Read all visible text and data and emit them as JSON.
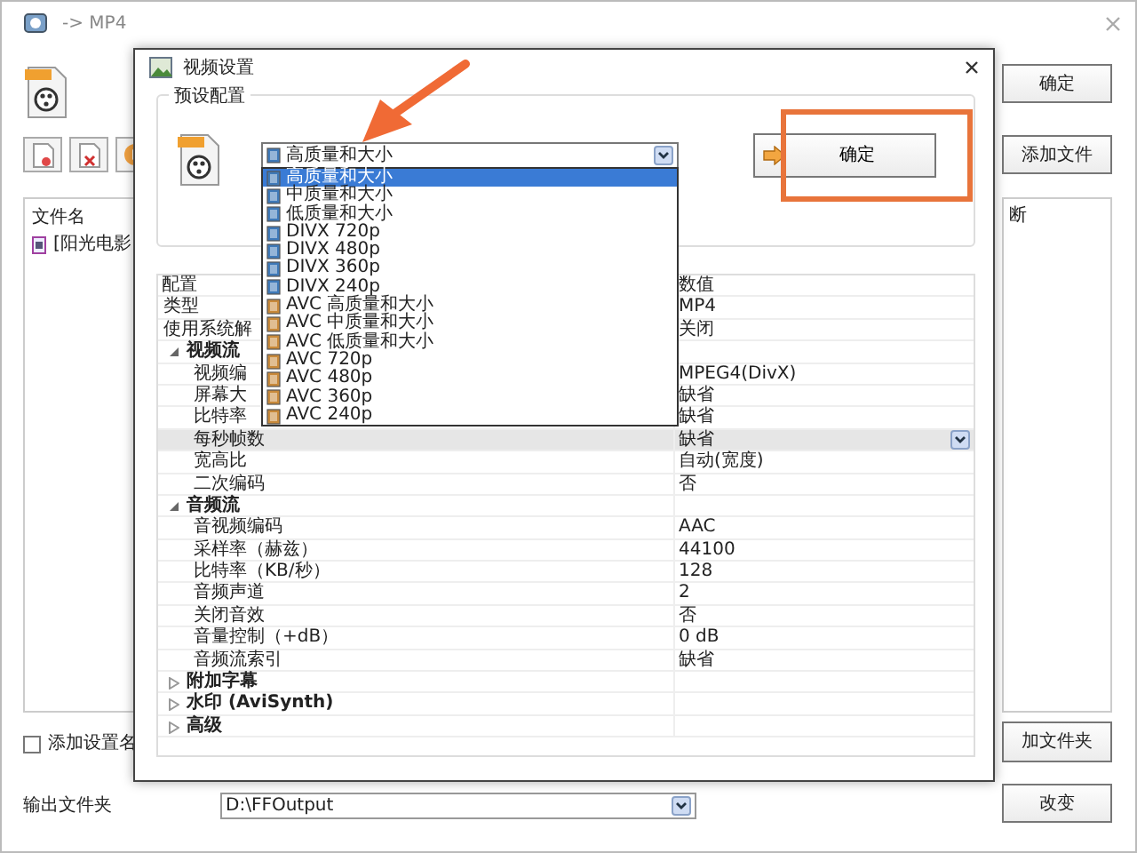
{
  "main_window": {
    "title": "-> MP4",
    "buttons": [
      {
        "label": "确定"
      },
      {
        "label": "添加文件"
      }
    ],
    "file_list": {
      "header": "文件名",
      "items": [
        "[阳光电影"
      ]
    },
    "status_panel": {
      "header": "断"
    },
    "add_folder_button": "加文件夹",
    "add_setting_name": {
      "label": "添加设置名",
      "checked": false
    },
    "output_folder": {
      "label": "输出文件夹",
      "value": "D:\\FFOutput",
      "change_button": "改变"
    }
  },
  "dialog": {
    "title": "视频设置",
    "preset": {
      "legend": "预设配置",
      "value": "高质量和大小",
      "expanded": true,
      "ok_button": "确定",
      "options": [
        {
          "label": "高质量和大小",
          "kind": "standard",
          "selected": true
        },
        {
          "label": "中质量和大小",
          "kind": "standard",
          "selected": false
        },
        {
          "label": "低质量和大小",
          "kind": "standard",
          "selected": false
        },
        {
          "label": "DIVX 720p",
          "kind": "standard",
          "selected": false
        },
        {
          "label": "DIVX 480p",
          "kind": "standard",
          "selected": false
        },
        {
          "label": "DIVX 360p",
          "kind": "standard",
          "selected": false
        },
        {
          "label": "DIVX 240p",
          "kind": "standard",
          "selected": false
        },
        {
          "label": "AVC 高质量和大小",
          "kind": "avc",
          "selected": false
        },
        {
          "label": "AVC 中质量和大小",
          "kind": "avc",
          "selected": false
        },
        {
          "label": "AVC 低质量和大小",
          "kind": "avc",
          "selected": false
        },
        {
          "label": "AVC 720p",
          "kind": "avc",
          "selected": false
        },
        {
          "label": "AVC 480p",
          "kind": "avc",
          "selected": false
        },
        {
          "label": "AVC 360p",
          "kind": "avc",
          "selected": false
        },
        {
          "label": "AVC 240p",
          "kind": "avc",
          "selected": false
        }
      ]
    },
    "properties": {
      "columns": [
        "配置",
        "数值"
      ],
      "rows": [
        {
          "kind": "prop",
          "name": "类型",
          "value": "MP4",
          "selected": false
        },
        {
          "kind": "prop",
          "name": "使用系统解",
          "value": "关闭",
          "selected": false
        },
        {
          "kind": "group",
          "name": "视频流",
          "expanded": true,
          "selected": false,
          "children": [
            {
              "kind": "prop",
              "name": "视频编",
              "value": "MPEG4(DivX)",
              "selected": false
            },
            {
              "kind": "prop",
              "name": "屏幕大",
              "value": "缺省",
              "selected": false
            },
            {
              "kind": "prop",
              "name": "比特率",
              "value": "缺省",
              "selected": false
            },
            {
              "kind": "prop",
              "name": "每秒帧数",
              "value": "缺省",
              "selected": true
            },
            {
              "kind": "prop",
              "name": "宽高比",
              "value": "自动(宽度)",
              "selected": false
            },
            {
              "kind": "prop",
              "name": "二次编码",
              "value": "否",
              "selected": false
            }
          ]
        },
        {
          "kind": "group",
          "name": "音频流",
          "expanded": true,
          "selected": false,
          "children": [
            {
              "kind": "prop",
              "name": "音视频编码",
              "value": "AAC",
              "selected": false
            },
            {
              "kind": "prop",
              "name": "采样率（赫兹）",
              "value": "44100",
              "selected": false
            },
            {
              "kind": "prop",
              "name": "比特率（KB/秒）",
              "value": "128",
              "selected": false
            },
            {
              "kind": "prop",
              "name": "音频声道",
              "value": "2",
              "selected": false
            },
            {
              "kind": "prop",
              "name": "关闭音效",
              "value": "否",
              "selected": false
            },
            {
              "kind": "prop",
              "name": "音量控制（+dB）",
              "value": "0 dB",
              "selected": false
            },
            {
              "kind": "prop",
              "name": "音频流索引",
              "value": "缺省",
              "selected": false
            }
          ]
        },
        {
          "kind": "group",
          "name": "附加字幕",
          "expanded": false,
          "selected": false,
          "children": []
        },
        {
          "kind": "group",
          "name": "水印 (AviSynth)",
          "expanded": false,
          "selected": false,
          "children": []
        },
        {
          "kind": "group",
          "name": "高级",
          "expanded": false,
          "selected": false,
          "children": []
        }
      ]
    }
  },
  "annotations": {
    "arrow": true,
    "highlight_box": true
  }
}
